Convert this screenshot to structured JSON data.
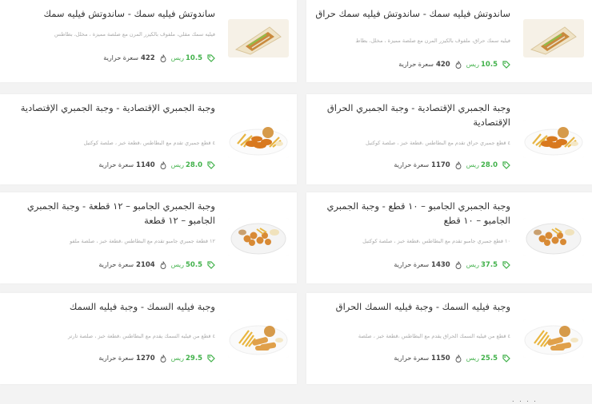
{
  "currency": "ريس",
  "calorie_unit": "سعرة حرارية",
  "items": [
    {
      "title": "ساندوتش فيليه سمك - ساندوتش فيليه سمك حراق",
      "desc": "فيليه سمك حراق، ملفوف بالكيزر المرن مع صلصة مميزة ، مخلل، بطاط",
      "price": "10.5",
      "calories": "420",
      "image": "sandwich-image"
    },
    {
      "title": "ساندوتش فيليه سمك - ساندوتش فيليه سمك",
      "desc": "فيليه سمك مقلي، ملفوف بالكيزر المرن مع صلصة مميزة ، مخلل، بطاطس",
      "price": "10.5",
      "calories": "422",
      "image": "sandwich-image"
    },
    {
      "title": "وجبة الجمبري الإقتصادية - وجبة الجمبري الحراق الإقتصادية",
      "desc": "٤ قطع جمبري حراق تقدم مع البطاطس ،قطعة خبز ، صلصة كوكتيل",
      "price": "28.0",
      "calories": "1170",
      "image": "shrimp-meal-image"
    },
    {
      "title": "وجبة الجمبري الإقتصادية - وجبة الجمبري الإقتصادية",
      "desc": "٤ قطع جمبري تقدم مع البطاطس ،قطعة خبز ، صلصة كوكتيل",
      "price": "28.0",
      "calories": "1140",
      "image": "shrimp-meal-image"
    },
    {
      "title": "وجبة الجمبري الجامبو – ١٠ قطع - وجبة الجمبري الجامبو – ١٠ قطع",
      "desc": "١٠ قطع جمبري جامبو تقدم مع البطاطس ،قطعة خبز ، صلصة كوكتيل",
      "price": "37.5",
      "calories": "1430",
      "image": "jumbo-plate-image"
    },
    {
      "title": "وجبة الجمبري الجامبو – ١٢ قطعة - وجبة الجمبري الجامبو – ١٢ قطعة",
      "desc": "١٢ قطعة جمبري جامبو تقدم مع البطاطس ،قطعة خبز ، صلصة ملفو",
      "price": "50.5",
      "calories": "2104",
      "image": "jumbo-plate-image"
    },
    {
      "title": "وجبة فيليه السمك - وجبة فيليه السمك الحراق",
      "desc": "٤ قطع من فيليه السمك الحراق يقدم مع البطاطس ،قطعة خبز ، صلصة",
      "price": "25.5",
      "calories": "1150",
      "image": "fish-meal-image"
    },
    {
      "title": "وجبة فيليه السمك - وجبة فيليه السمك",
      "desc": "٤ قطع من فيليه السمك يقدم مع البطاطس ،قطعة خبز ، صلصة تارتر",
      "price": "29.5",
      "calories": "1270",
      "image": "fish-meal-image"
    }
  ],
  "colors": {
    "price": "#41b14a",
    "text": "#333333",
    "muted": "#aaaaaa",
    "background": "#f3f3f3"
  }
}
